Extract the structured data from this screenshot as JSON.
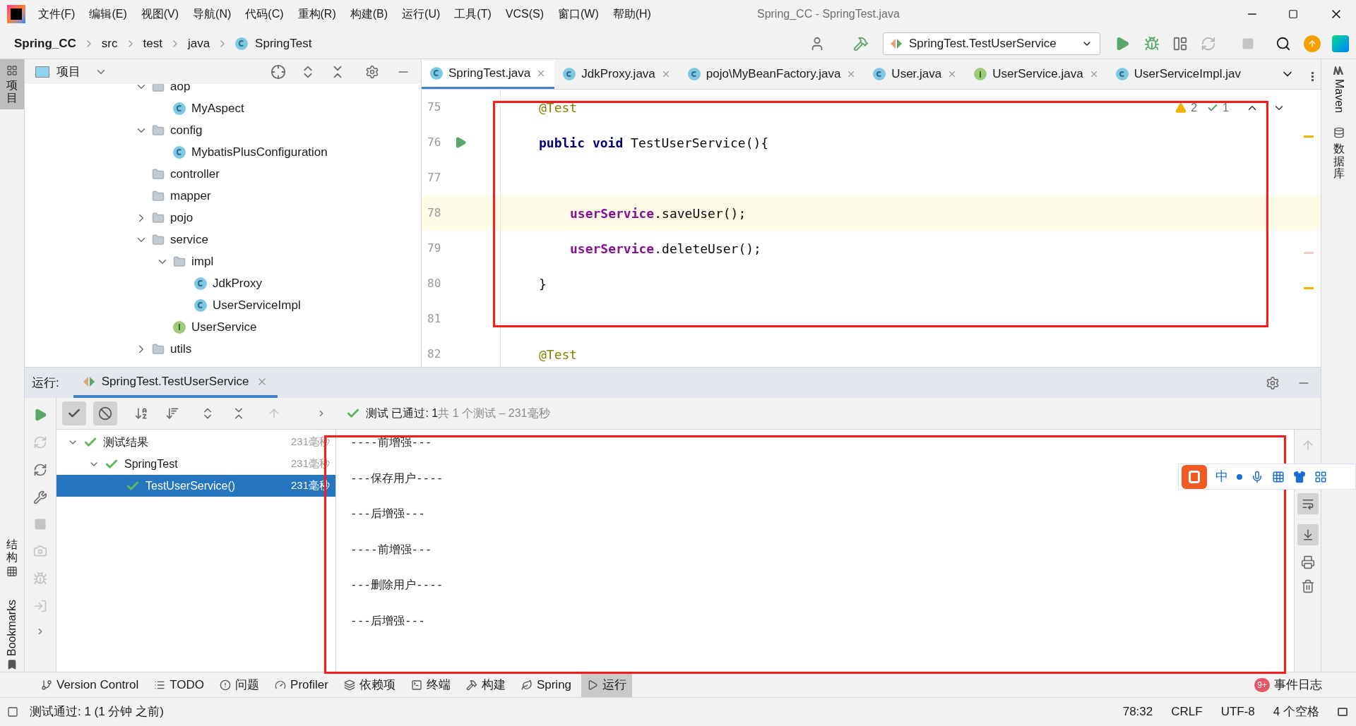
{
  "title_bar": {
    "menu": [
      "文件(F)",
      "编辑(E)",
      "视图(V)",
      "导航(N)",
      "代码(C)",
      "重构(R)",
      "构建(B)",
      "运行(U)",
      "工具(T)",
      "VCS(S)",
      "窗口(W)",
      "帮助(H)"
    ],
    "title": "Spring_CC - SpringTest.java"
  },
  "nav_bar": {
    "breadcrumbs": [
      {
        "label": "Spring_CC",
        "kind": "project"
      },
      {
        "label": "src",
        "kind": "folder"
      },
      {
        "label": "test",
        "kind": "folder"
      },
      {
        "label": "java",
        "kind": "folder"
      },
      {
        "label": "SpringTest",
        "kind": "class"
      }
    ],
    "run_config": "SpringTest.TestUserService"
  },
  "left_stripe": [
    {
      "label": "项目",
      "selected": true
    },
    {
      "label": "结构",
      "selected": false
    },
    {
      "label": "Bookmarks",
      "selected": false
    }
  ],
  "project_panel": {
    "title": "项目",
    "tree": [
      {
        "label": "aop",
        "kind": "folder",
        "expanded": true,
        "children": [
          {
            "label": "MyAspect",
            "kind": "class"
          }
        ]
      },
      {
        "label": "config",
        "kind": "folder",
        "expanded": true,
        "children": [
          {
            "label": "MybatisPlusConfiguration",
            "kind": "class"
          }
        ]
      },
      {
        "label": "controller",
        "kind": "folder"
      },
      {
        "label": "mapper",
        "kind": "folder"
      },
      {
        "label": "pojo",
        "kind": "folder",
        "expanded": false,
        "has_children": true
      },
      {
        "label": "service",
        "kind": "folder",
        "expanded": true,
        "children": [
          {
            "label": "impl",
            "kind": "folder",
            "expanded": true,
            "children": [
              {
                "label": "JdkProxy",
                "kind": "class"
              },
              {
                "label": "UserServiceImpl",
                "kind": "class"
              }
            ]
          },
          {
            "label": "UserService",
            "kind": "interface"
          }
        ]
      },
      {
        "label": "utils",
        "kind": "folder",
        "expanded": false,
        "has_children": true
      }
    ]
  },
  "editor": {
    "tabs": [
      {
        "label": "SpringTest.java",
        "kind": "class",
        "selected": true,
        "closable": true
      },
      {
        "label": "JdkProxy.java",
        "kind": "class",
        "selected": false,
        "closable": true
      },
      {
        "label": "pojo\\MyBeanFactory.java",
        "kind": "class",
        "selected": false,
        "closable": true
      },
      {
        "label": "User.java",
        "kind": "class",
        "selected": false,
        "closable": true
      },
      {
        "label": "UserService.java",
        "kind": "interface",
        "selected": false,
        "closable": true
      },
      {
        "label": "UserServiceImpl.jav",
        "kind": "class",
        "selected": false,
        "closable": false
      }
    ],
    "inspection": {
      "warnings": "2",
      "weak_warnings": "1"
    },
    "lines": [
      {
        "number": "75",
        "current": false,
        "run_marker": false,
        "kind": "member",
        "tokens": [
          {
            "text": "@Test",
            "kind": "annotation"
          }
        ]
      },
      {
        "number": "76",
        "current": false,
        "run_marker": true,
        "kind": "member",
        "tokens": [
          {
            "text": "public",
            "kind": "keyword"
          },
          {
            "text": "void",
            "kind": "keyword"
          },
          {
            "text": "TestUserService(){",
            "kind": "plain"
          }
        ]
      },
      {
        "number": "77",
        "current": false,
        "run_marker": false
      },
      {
        "number": "78",
        "current": true,
        "run_marker": false,
        "kind": "body",
        "tokens": [
          {
            "text": "userService",
            "kind": "field"
          },
          {
            "text": ".saveUser();",
            "kind": "plain"
          }
        ]
      },
      {
        "number": "79",
        "current": false,
        "run_marker": false,
        "kind": "body",
        "tokens": [
          {
            "text": "userService",
            "kind": "field"
          },
          {
            "text": ".deleteUser();",
            "kind": "plain"
          }
        ]
      },
      {
        "number": "80",
        "current": false,
        "run_marker": false,
        "kind": "member",
        "tokens": [
          {
            "text": "}",
            "kind": "plain"
          }
        ]
      },
      {
        "number": "81",
        "current": false,
        "run_marker": false
      },
      {
        "number": "82",
        "current": false,
        "run_marker": false,
        "kind": "member",
        "tokens": [
          {
            "text": "@Test",
            "kind": "annotation"
          }
        ]
      }
    ]
  },
  "right_stripe": [
    "Maven",
    "数据库"
  ],
  "run_panel": {
    "label": "运行:",
    "tab": "SpringTest.TestUserService",
    "status": {
      "passed": "测试 已通过: 1",
      "detail": "共 1 个测试 – 231毫秒"
    },
    "tests": [
      {
        "label": "测试结果",
        "time": "231毫秒",
        "selected": false,
        "expanded": true,
        "children": [
          {
            "label": "SpringTest",
            "time": "231毫秒",
            "selected": false,
            "expanded": true,
            "children": [
              {
                "label": "TestUserService()",
                "time": "231毫秒",
                "selected": true
              }
            ]
          }
        ]
      }
    ],
    "console": [
      "----前增强---",
      "---保存用户----",
      "---后增强---",
      "----前增强---",
      "---删除用户----",
      "---后增强---"
    ]
  },
  "ime_toolbar": {
    "label": "中"
  },
  "tool_windows": [
    {
      "label": "Version Control",
      "kind": "vcs",
      "selected": false
    },
    {
      "label": "TODO",
      "kind": "todo",
      "selected": false
    },
    {
      "label": "问题",
      "kind": "problems",
      "selected": false
    },
    {
      "label": "Profiler",
      "kind": "profiler",
      "selected": false
    },
    {
      "label": "依赖项",
      "kind": "deps",
      "selected": false
    },
    {
      "label": "终端",
      "kind": "terminal",
      "selected": false
    },
    {
      "label": "构建",
      "kind": "build",
      "selected": false
    },
    {
      "label": "Spring",
      "kind": "spring",
      "selected": false
    },
    {
      "label": "运行",
      "kind": "run",
      "selected": true
    }
  ],
  "event_log": {
    "label": "事件日志",
    "badge": "9+"
  },
  "status_bar": {
    "message": "测试通过: 1 (1 分钟 之前)",
    "items": [
      "78:32",
      "CRLF",
      "UTF-8",
      "4 个空格"
    ]
  }
}
